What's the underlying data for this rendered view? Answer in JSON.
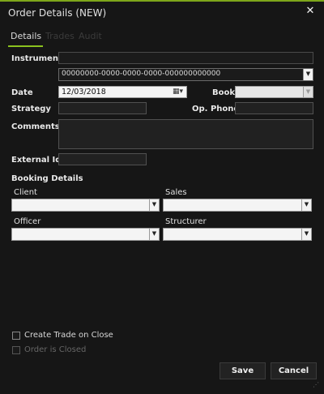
{
  "window": {
    "title": "Order Details (NEW)",
    "close_glyph": "✕"
  },
  "tabs": [
    {
      "label": "Details"
    },
    {
      "label": "Trades"
    },
    {
      "label": "Audit"
    }
  ],
  "form": {
    "instrument_label": "Instrument",
    "instrument_value": "",
    "instrument_id_value": "00000000-0000-0000-0000-000000000000",
    "date_label": "Date",
    "date_value": "12/03/2018",
    "book_label": "Book",
    "book_value": "",
    "strategy_label": "Strategy",
    "strategy_value": "",
    "op_phone_label": "Op. Phone",
    "op_phone_value": "",
    "comments_label": "Comments",
    "comments_value": "",
    "external_id_label": "External Id",
    "external_id_value": ""
  },
  "booking": {
    "title": "Booking Details",
    "client_label": "Client",
    "client_value": "",
    "sales_label": "Sales",
    "sales_value": "",
    "officer_label": "Officer",
    "officer_value": "",
    "structurer_label": "Structurer",
    "structurer_value": ""
  },
  "options": {
    "create_trade_on_close_label": "Create Trade on Close",
    "create_trade_on_close_checked": false,
    "order_is_closed_label": "Order is Closed",
    "order_is_closed_checked": false
  },
  "actions": {
    "save_label": "Save",
    "cancel_label": "Cancel"
  },
  "colors": {
    "accent": "#8bc21f",
    "background": "#161616"
  }
}
